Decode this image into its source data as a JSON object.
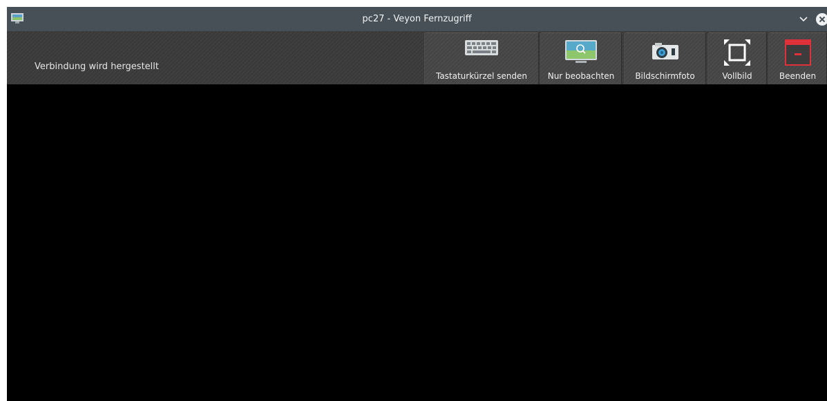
{
  "window": {
    "title": "pc27 - Veyon Fernzugriff",
    "icons": {
      "app": "veyon-monitor-icon",
      "minimize": "chevron-down-icon",
      "close": "close-circle-icon"
    }
  },
  "toolbar": {
    "status_text": "Verbindung wird hergestellt",
    "buttons": [
      {
        "label": "Tastaturkürzel senden",
        "icon": "keyboard-icon"
      },
      {
        "label": "Nur beobachten",
        "icon": "monitor-magnifier-icon"
      },
      {
        "label": "Bildschirmfoto",
        "icon": "camera-icon"
      },
      {
        "label": "Vollbild",
        "icon": "fullscreen-icon"
      },
      {
        "label": "Beenden",
        "icon": "exit-window-icon"
      }
    ]
  },
  "colors": {
    "titlebar": "#475057",
    "toolbar": "#3a3a3a",
    "remote_bg": "#000000",
    "exit_red": "#e0313b"
  }
}
